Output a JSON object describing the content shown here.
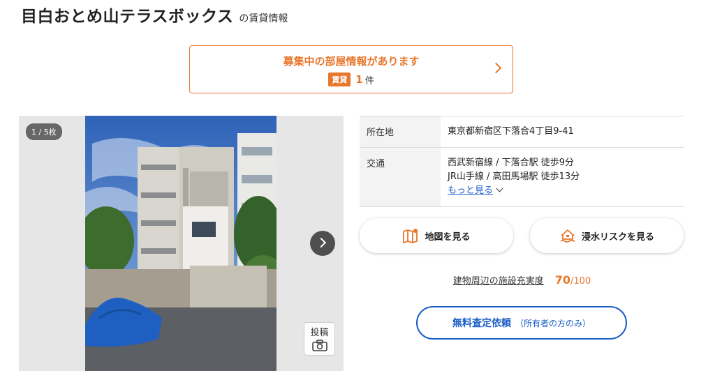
{
  "header": {
    "title": "目白おとめ山テラスボックス",
    "title_suffix": "の賃貸情報"
  },
  "vacancy": {
    "heading": "募集中の部屋情報があります",
    "badge": "賃貸",
    "count": "1",
    "count_unit": "件",
    "icon": "chevron-right-icon"
  },
  "gallery": {
    "counter": "1 / 5枚",
    "post_label": "投稿",
    "post_icon": "camera-icon",
    "next_icon": "chevron-right-icon"
  },
  "info": {
    "address_label": "所在地",
    "address_value": "東京都新宿区下落合4丁目9-41",
    "transport_label": "交通",
    "transport_lines": [
      "西武新宿線 / 下落合駅 徒歩9分",
      "JR山手線 / 高田馬場駅 徒歩13分"
    ],
    "more_link": "もっと見る"
  },
  "actions": {
    "map_label": "地図を見る",
    "map_icon": "map-icon",
    "flood_label": "浸水リスクを見る",
    "flood_icon": "flood-house-icon"
  },
  "score": {
    "label": "建物周辺の施設充実度",
    "value": "70",
    "max": "/100"
  },
  "cta": {
    "main": "無料査定依頼",
    "sub": "（所有者の方のみ）"
  },
  "colors": {
    "accent_orange": "#e8772e",
    "link_blue": "#1a5ec7"
  }
}
